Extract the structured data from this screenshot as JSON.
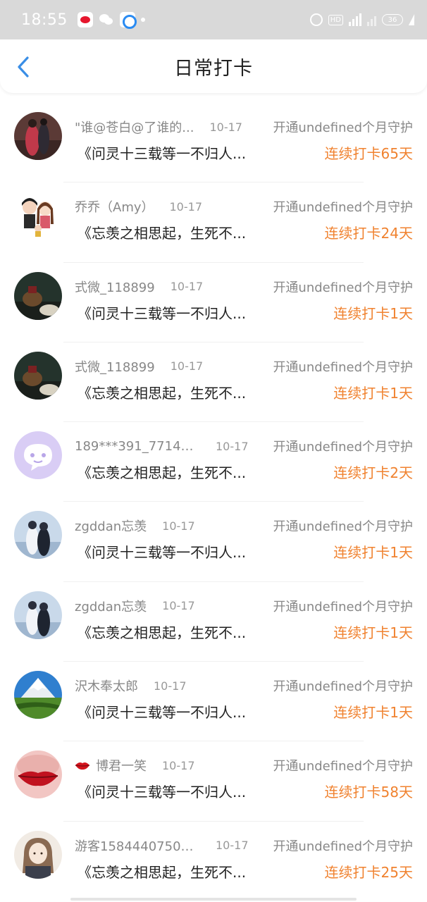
{
  "status_bar": {
    "time": "18:55",
    "hd_label": "HD",
    "battery_level": "36"
  },
  "header": {
    "title": "日常打卡"
  },
  "list": {
    "items": [
      {
        "user_name": "\"谁@苍白@了谁的...",
        "date": "10-17",
        "guard_text": "开通undefined个月守护",
        "content": "《问灵十三载等一不归人...",
        "streak": "连续打卡65天",
        "avatar_icon": "photo-avatar-couple"
      },
      {
        "user_name": "乔乔（Amy）",
        "date": "10-17",
        "guard_text": "开通undefined个月守护",
        "content": "《忘羡之相思起，生死不...",
        "streak": "连续打卡24天",
        "avatar_icon": "cartoon-couple-avatar"
      },
      {
        "user_name": "式微_118899",
        "date": "10-17",
        "guard_text": "开通undefined个月守护",
        "content": "《问灵十三载等一不归人...",
        "streak": "连续打卡1天",
        "avatar_icon": "teapot-avatar"
      },
      {
        "user_name": "式微_118899",
        "date": "10-17",
        "guard_text": "开通undefined个月守护",
        "content": "《忘羡之相思起，生死不...",
        "streak": "连续打卡1天",
        "avatar_icon": "teapot-avatar"
      },
      {
        "user_name": "189***391_77141...",
        "date": "10-17",
        "guard_text": "开通undefined个月守护",
        "content": "《忘羡之相思起，生死不...",
        "streak": "连续打卡2天",
        "avatar_icon": "default-chat-avatar"
      },
      {
        "user_name": "zgddan忘羡",
        "date": "10-17",
        "guard_text": "开通undefined个月守护",
        "content": "《问灵十三载等一不归人...",
        "streak": "连续打卡1天",
        "avatar_icon": "drama-avatar"
      },
      {
        "user_name": "zgddan忘羡",
        "date": "10-17",
        "guard_text": "开通undefined个月守护",
        "content": "《忘羡之相思起，生死不...",
        "streak": "连续打卡1天",
        "avatar_icon": "drama-avatar"
      },
      {
        "user_name": "沢木奉太郎",
        "date": "10-17",
        "guard_text": "开通undefined个月守护",
        "content": "《问灵十三载等一不归人...",
        "streak": "连续打卡1天",
        "avatar_icon": "mountain-avatar"
      },
      {
        "user_name": "博君一笑",
        "date": "10-17",
        "guard_text": "开通undefined个月守护",
        "content": "《问灵十三载等一不归人...",
        "streak": "连续打卡58天",
        "avatar_icon": "lips-avatar",
        "badge_icon": "lips-badge-icon"
      },
      {
        "user_name": "游客15844407500...",
        "date": "10-17",
        "guard_text": "开通undefined个月守护",
        "content": "《忘羡之相思起，生死不...",
        "streak": "连续打卡25天",
        "avatar_icon": "girl-sketch-avatar"
      }
    ]
  },
  "colors": {
    "accent": "#3a8ee6",
    "streak": "#f0822f",
    "status_bar": "#d9d9d9"
  }
}
